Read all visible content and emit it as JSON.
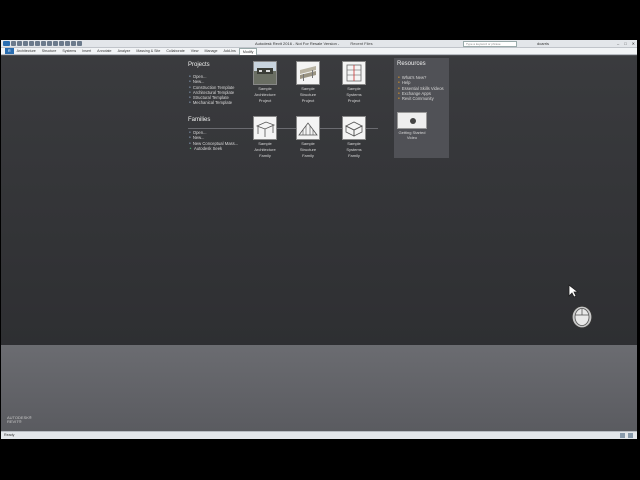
{
  "window": {
    "title": "Autodesk Revit 2016 - Not For Resale Version -",
    "tab_title": "Recent Files",
    "search_placeholder": "Type a keyword or phrase",
    "user": "dcarris",
    "min": "–",
    "max": "□",
    "close": "✕"
  },
  "ribbon": {
    "tabs": [
      {
        "label": "R"
      },
      {
        "label": "Architecture"
      },
      {
        "label": "Structure"
      },
      {
        "label": "Systems"
      },
      {
        "label": "Insert"
      },
      {
        "label": "Annotate"
      },
      {
        "label": "Analyze"
      },
      {
        "label": "Massing & Site"
      },
      {
        "label": "Collaborate"
      },
      {
        "label": "View"
      },
      {
        "label": "Manage"
      },
      {
        "label": "Add-Ins"
      },
      {
        "label": "Modify"
      }
    ]
  },
  "projects": {
    "heading": "Projects",
    "links": [
      "Open...",
      "New...",
      "Construction Template",
      "Architectural Template",
      "Structural Template",
      "Mechanical Template"
    ],
    "thumbs": [
      {
        "caption_1": "Sample",
        "caption_2": "Architecture",
        "caption_3": "Project"
      },
      {
        "caption_1": "Sample",
        "caption_2": "Structure",
        "caption_3": "Project"
      },
      {
        "caption_1": "Sample",
        "caption_2": "Systems",
        "caption_3": "Project"
      }
    ]
  },
  "families": {
    "heading": "Families",
    "links": [
      "Open...",
      "New...",
      "New Conceptual Mass...",
      "Autodesk Seek"
    ],
    "thumbs": [
      {
        "caption_1": "Sample",
        "caption_2": "Architecture",
        "caption_3": "Family"
      },
      {
        "caption_1": "Sample",
        "caption_2": "Structure",
        "caption_3": "Family"
      },
      {
        "caption_1": "Sample",
        "caption_2": "Systems",
        "caption_3": "Family"
      }
    ]
  },
  "resources": {
    "heading": "Resources",
    "links": [
      "What's New?",
      "Help",
      "Essential Skills Videos",
      "Exchange Apps",
      "Revit Community"
    ],
    "video_caption_1": "Getting Started",
    "video_caption_2": "Video"
  },
  "branding": {
    "line1": "AUTODESK®",
    "line2": "REVIT®"
  },
  "status": {
    "text": "Ready"
  }
}
